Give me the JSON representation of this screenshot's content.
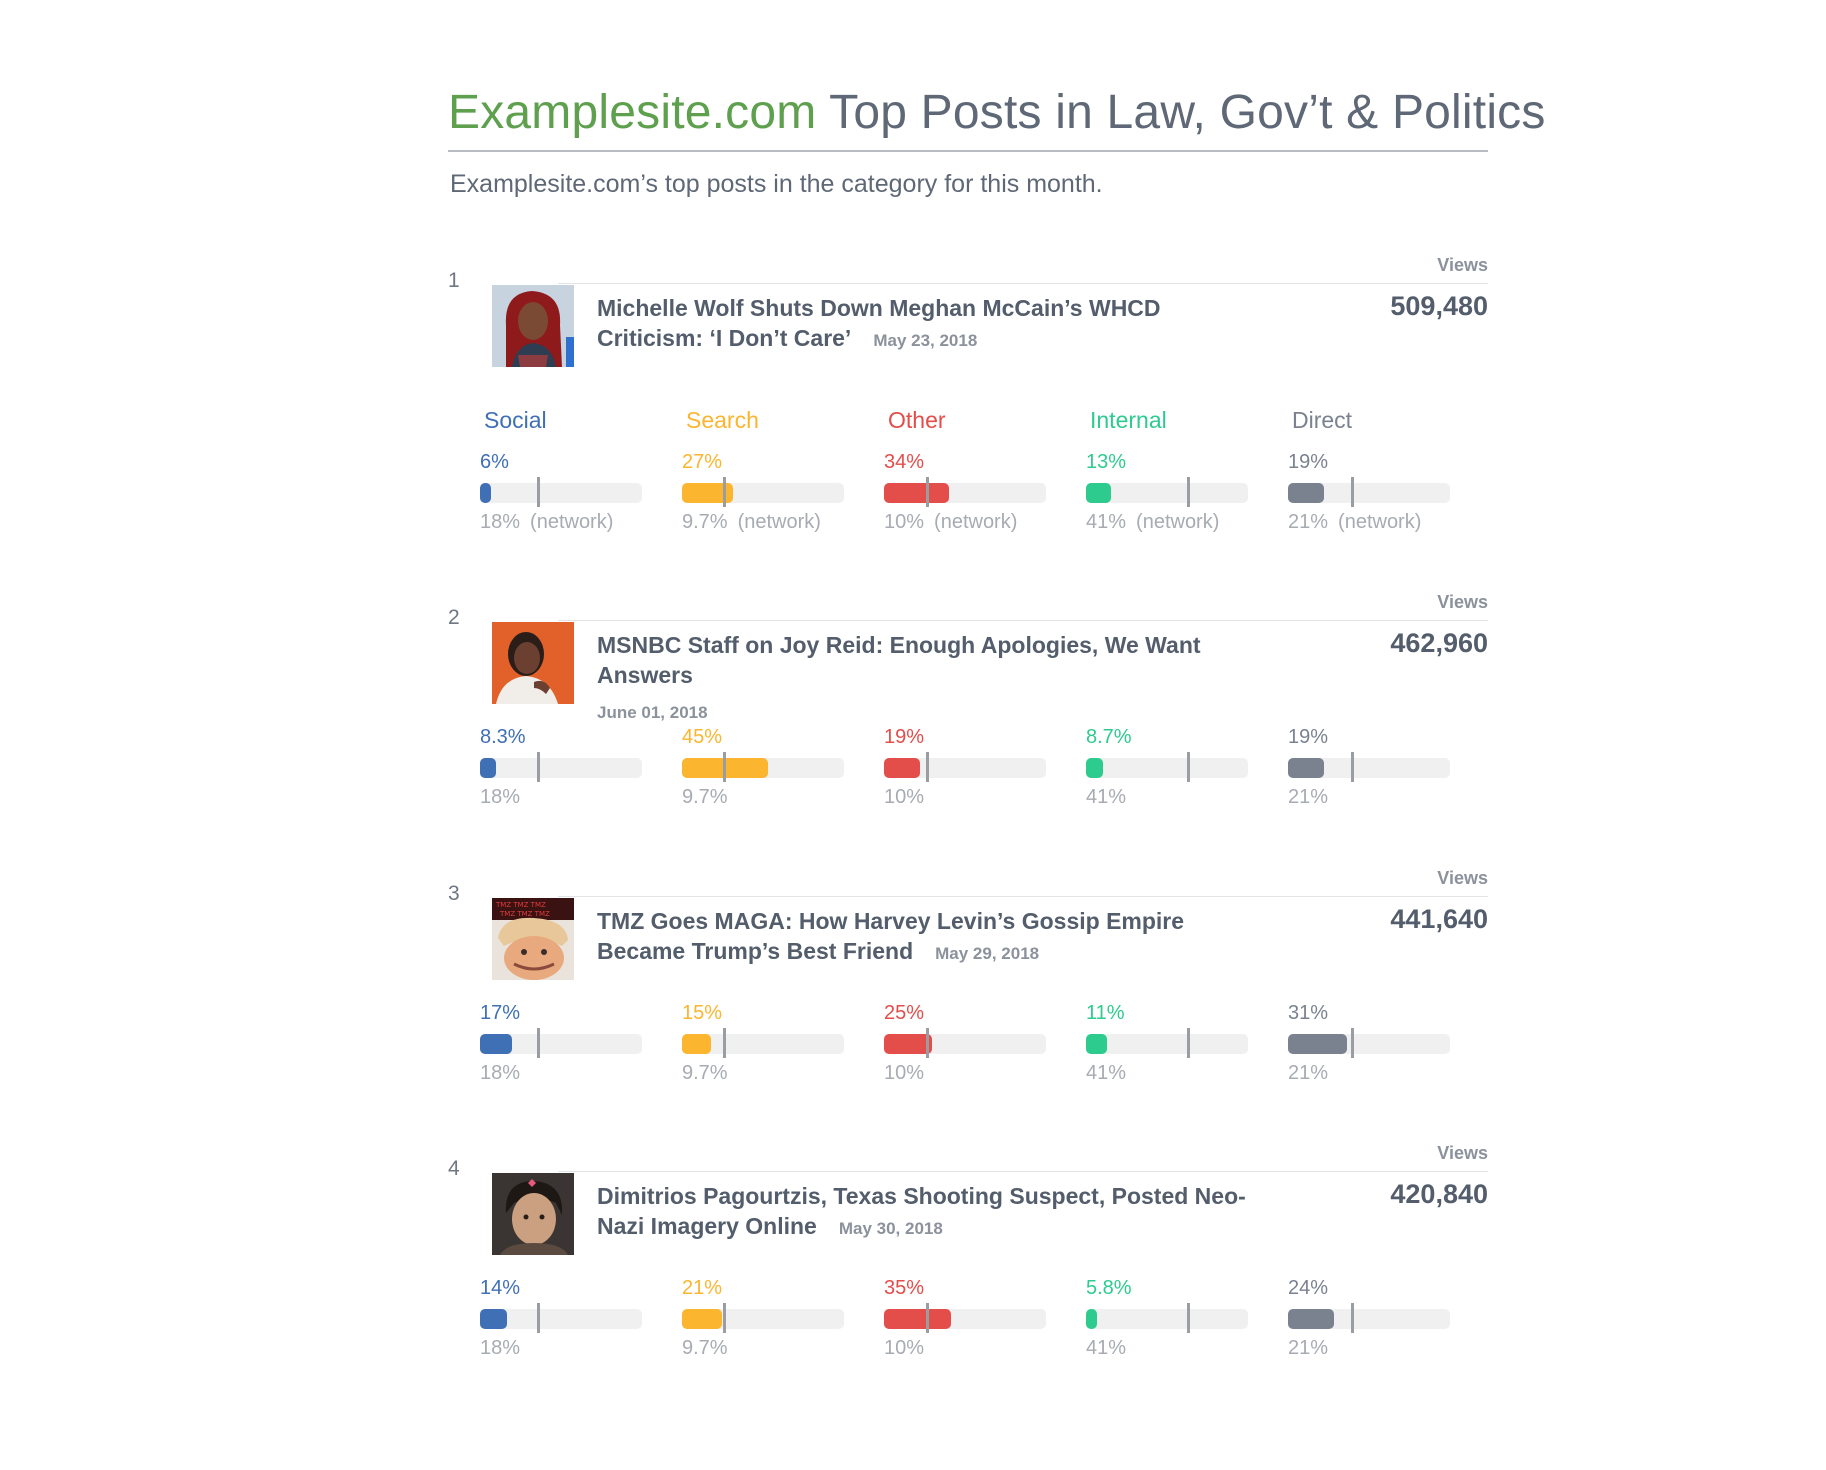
{
  "header": {
    "site_name": "Examplesite.com",
    "title_rest": " Top Posts in Law, Gov’t & Politics",
    "subtitle": "Examplesite.com’s top posts in the category for this month."
  },
  "colors": {
    "site": "#5ea04e",
    "Social": "#3f6fb5",
    "Search": "#fbb52f",
    "Other": "#e34d4a",
    "Internal": "#2ecb8e",
    "Direct": "#7a8290",
    "marker": "#9a9da3",
    "track": "#f0f0f1"
  },
  "views_label": "Views",
  "channel_labels": [
    "Social",
    "Search",
    "Other",
    "Internal",
    "Direct"
  ],
  "network_suffix": "(network)",
  "posts": [
    {
      "rank": "1",
      "title": "Michelle Wolf Shuts Down Meghan McCain’s WHCD Criticism: ‘I Don’t Care’",
      "date": "May 23, 2018",
      "views": "509,480",
      "thumbnail": "woman-red-hair-photo",
      "channels": [
        {
          "pct": "6%",
          "value": 6,
          "network": "18%",
          "network_value": 18
        },
        {
          "pct": "27%",
          "value": 27,
          "network": "9.7%",
          "network_value": 9.7
        },
        {
          "pct": "34%",
          "value": 34,
          "network": "10%",
          "network_value": 10
        },
        {
          "pct": "13%",
          "value": 13,
          "network": "41%",
          "network_value": 41
        },
        {
          "pct": "19%",
          "value": 19,
          "network": "21%",
          "network_value": 21
        }
      ]
    },
    {
      "rank": "2",
      "title": "MSNBC Staff on Joy Reid: Enough Apologies, We Want Answers",
      "date": "June 01, 2018",
      "views": "462,960",
      "thumbnail": "woman-orange-background-photo",
      "channels": [
        {
          "pct": "8.3%",
          "value": 8.3,
          "network": "18%",
          "network_value": 18
        },
        {
          "pct": "45%",
          "value": 45,
          "network": "9.7%",
          "network_value": 9.7
        },
        {
          "pct": "19%",
          "value": 19,
          "network": "10%",
          "network_value": 10
        },
        {
          "pct": "8.7%",
          "value": 8.7,
          "network": "41%",
          "network_value": 41
        },
        {
          "pct": "19%",
          "value": 19,
          "network": "21%",
          "network_value": 21
        }
      ]
    },
    {
      "rank": "3",
      "title": "TMZ Goes MAGA: How Harvey Levin’s Gossip Empire Became Trump’s Best Friend",
      "date": "May 29, 2018",
      "views": "441,640",
      "thumbnail": "tmz-illustration",
      "channels": [
        {
          "pct": "17%",
          "value": 17,
          "network": "18%",
          "network_value": 18
        },
        {
          "pct": "15%",
          "value": 15,
          "network": "9.7%",
          "network_value": 9.7
        },
        {
          "pct": "25%",
          "value": 25,
          "network": "10%",
          "network_value": 10
        },
        {
          "pct": "11%",
          "value": 11,
          "network": "41%",
          "network_value": 41
        },
        {
          "pct": "31%",
          "value": 31,
          "network": "21%",
          "network_value": 21
        }
      ]
    },
    {
      "rank": "4",
      "title": "Dimitrios Pagourtzis, Texas Shooting Suspect, Posted Neo-Nazi Imagery Online",
      "date": "May 30, 2018",
      "views": "420,840",
      "thumbnail": "young-man-photo",
      "channels": [
        {
          "pct": "14%",
          "value": 14,
          "network": "18%",
          "network_value": 18
        },
        {
          "pct": "21%",
          "value": 21,
          "network": "9.7%",
          "network_value": 9.7
        },
        {
          "pct": "35%",
          "value": 35,
          "network": "10%",
          "network_value": 10
        },
        {
          "pct": "5.8%",
          "value": 5.8,
          "network": "41%",
          "network_value": 41
        },
        {
          "pct": "24%",
          "value": 24,
          "network": "21%",
          "network_value": 21
        }
      ]
    }
  ]
}
